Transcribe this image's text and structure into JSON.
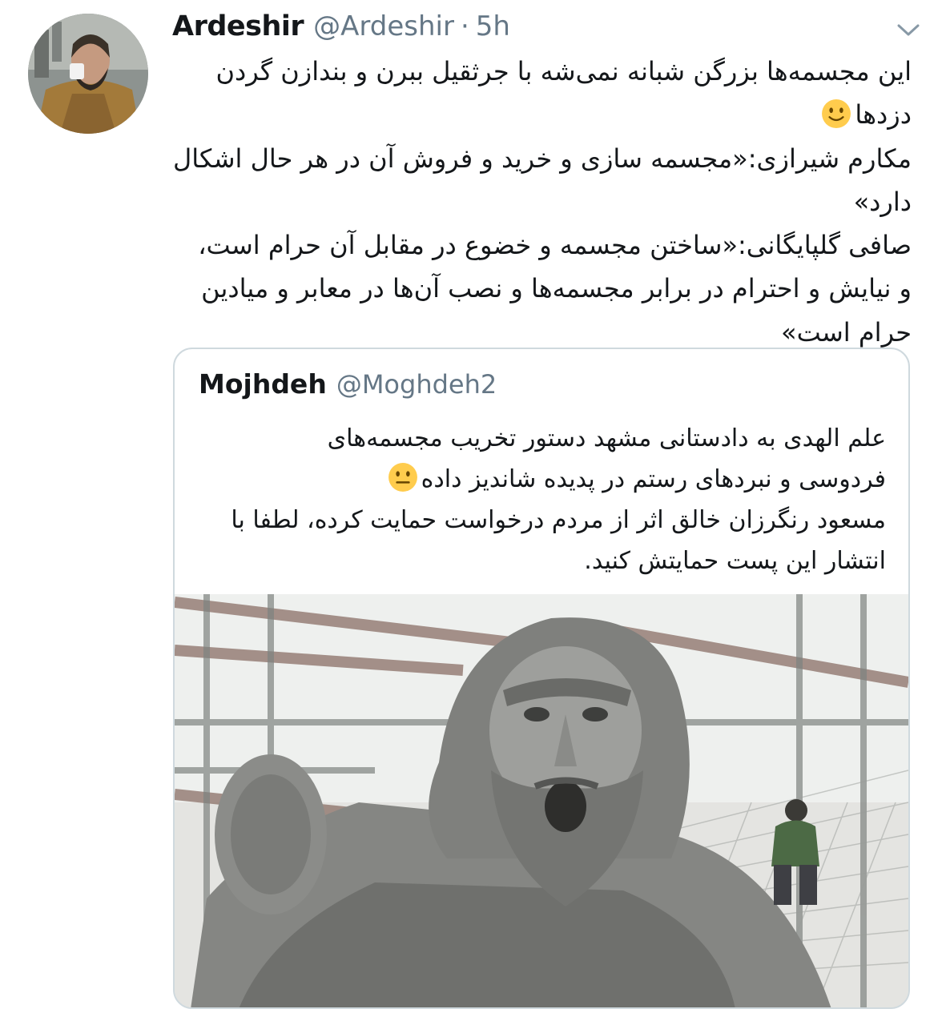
{
  "tweet": {
    "author_name": "Ardeshir",
    "author_handle": "@Ardeshir",
    "separator": "·",
    "time": "5h",
    "text_lines": [
      "این مجسمه‌ها بزرگن شبانه نمی‌شه با جرثقیل ببرن و بندازن گردن",
      "دزدها",
      "مکارم شیرازی:«مجسمه سازی و خرید و فروش آن در هر حال اشکال",
      "دارد»",
      "صافی گلپایگانی:«ساختن مجسمه و خضوع در مقابل آن حرام است،",
      "و نیایش و احترام در برابر مجسمه‌ها و نصب آن‌ها در معابر و میادین",
      "حرام است»"
    ],
    "emoji": "slightly-smiling-face-icon"
  },
  "quoted_tweet": {
    "author_name": "Mojhdeh",
    "author_handle": "@Moghdeh2",
    "text_lines": [
      "علم الهدی به دادستانی مشهد دستور تخریب مجسمه‌های",
      "فردوسی و نبردهای رستم در پدیده شاندیز داده",
      "مسعود رنگرزان خالق اثر از مردم درخواست حمایت کرده، لطفا با",
      "انتشار این پست حمایتش کنید."
    ],
    "emoji": "neutral-face-icon",
    "image": "statue-photo"
  },
  "colors": {
    "text": "#14171a",
    "secondary": "#657786",
    "border": "#cfd9de",
    "emoji": "#ffcc4d"
  }
}
